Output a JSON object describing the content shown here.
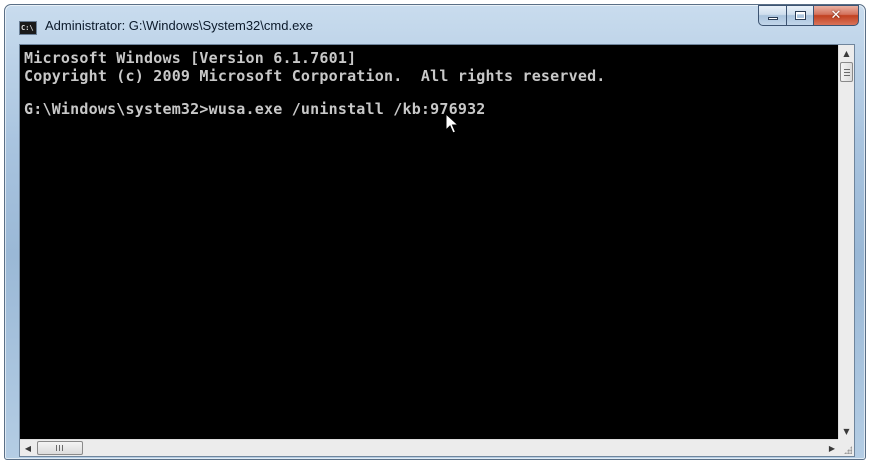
{
  "window": {
    "title": "Administrator: G:\\Windows\\System32\\cmd.exe",
    "icon": "cmd-icon"
  },
  "caption_buttons": {
    "minimize": "minimize-icon",
    "maximize": "maximize-icon",
    "close": "close-icon"
  },
  "console": {
    "lines": [
      "Microsoft Windows [Version 6.1.7601]",
      "Copyright (c) 2009 Microsoft Corporation.  All rights reserved.",
      "",
      "G:\\Windows\\system32>wusa.exe /uninstall /kb:976932"
    ],
    "colors": {
      "background": "#000000",
      "text": "#c8c8c8"
    }
  },
  "scrollbars": {
    "vertical_up_icon": "arrow-up-icon",
    "vertical_down_icon": "arrow-down-icon",
    "horizontal_left_icon": "arrow-left-icon",
    "horizontal_right_icon": "arrow-right-icon"
  }
}
